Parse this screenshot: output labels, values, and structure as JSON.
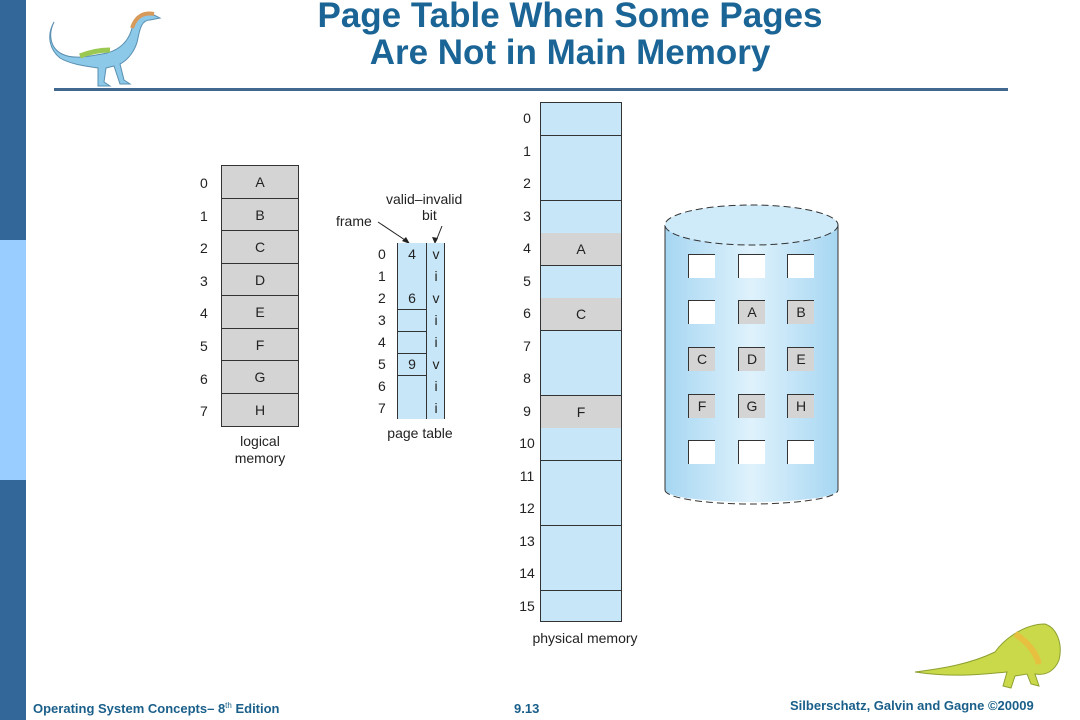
{
  "title": {
    "line1": "Page Table When Some Pages",
    "line2": "Are Not in Main Memory"
  },
  "colors": {
    "sidebar_dark": "#336699",
    "sidebar_light": "#99ccff",
    "title": "#1a6496",
    "memory_blue": "#c7e7f8",
    "page_gray": "#d4d4d4"
  },
  "logical_memory": {
    "label_line1": "logical",
    "label_line2": "memory",
    "pages": [
      {
        "index": "0",
        "content": "A"
      },
      {
        "index": "1",
        "content": "B"
      },
      {
        "index": "2",
        "content": "C"
      },
      {
        "index": "3",
        "content": "D"
      },
      {
        "index": "4",
        "content": "E"
      },
      {
        "index": "5",
        "content": "F"
      },
      {
        "index": "6",
        "content": "G"
      },
      {
        "index": "7",
        "content": "H"
      }
    ]
  },
  "page_table": {
    "label": "page table",
    "frame_label": "frame",
    "bit_label_line1": "valid–invalid",
    "bit_label_line2": "bit",
    "entries": [
      {
        "index": "0",
        "frame": "4",
        "bit": "v"
      },
      {
        "index": "1",
        "frame": "",
        "bit": "i"
      },
      {
        "index": "2",
        "frame": "6",
        "bit": "v"
      },
      {
        "index": "3",
        "frame": "",
        "bit": "i"
      },
      {
        "index": "4",
        "frame": "",
        "bit": "i"
      },
      {
        "index": "5",
        "frame": "9",
        "bit": "v"
      },
      {
        "index": "6",
        "frame": "",
        "bit": "i"
      },
      {
        "index": "7",
        "frame": "",
        "bit": "i"
      }
    ]
  },
  "physical_memory": {
    "label": "physical memory",
    "frames": [
      {
        "index": "0",
        "content": ""
      },
      {
        "index": "1",
        "content": ""
      },
      {
        "index": "2",
        "content": ""
      },
      {
        "index": "3",
        "content": ""
      },
      {
        "index": "4",
        "content": "A"
      },
      {
        "index": "5",
        "content": ""
      },
      {
        "index": "6",
        "content": "C"
      },
      {
        "index": "7",
        "content": ""
      },
      {
        "index": "8",
        "content": ""
      },
      {
        "index": "9",
        "content": "F"
      },
      {
        "index": "10",
        "content": ""
      },
      {
        "index": "11",
        "content": ""
      },
      {
        "index": "12",
        "content": ""
      },
      {
        "index": "13",
        "content": ""
      },
      {
        "index": "14",
        "content": ""
      },
      {
        "index": "15",
        "content": ""
      }
    ]
  },
  "disk": {
    "slots": [
      [
        "",
        "",
        ""
      ],
      [
        "",
        "A",
        "B"
      ],
      [
        "C",
        "D",
        "E"
      ],
      [
        "F",
        "G",
        "H"
      ],
      [
        "",
        "",
        ""
      ]
    ]
  },
  "footer": {
    "book": "Operating System Concepts– 8",
    "sup": "th",
    "edition": " Edition",
    "page": "9.13",
    "copyright": "Silberschatz, Galvin and Gagne ©20009"
  }
}
